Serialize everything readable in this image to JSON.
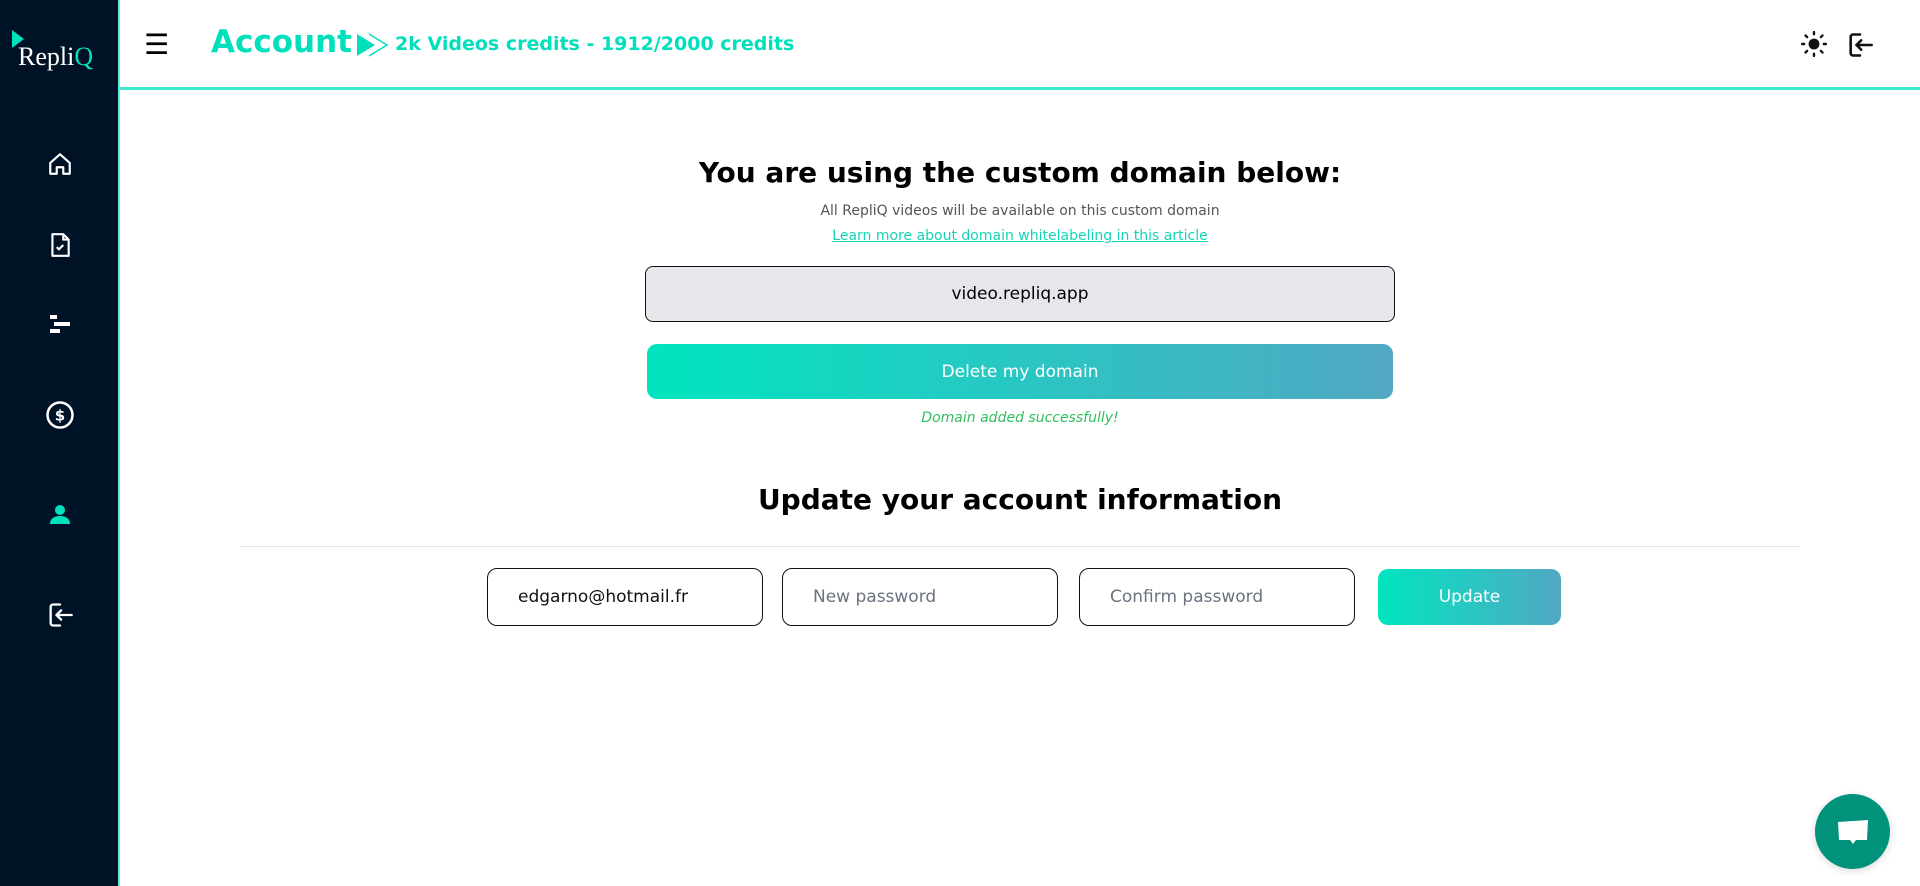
{
  "brand": {
    "name_prefix": "Repli",
    "name_suffix": "Q",
    "accent": "#00e0bd",
    "sidebar_bg": "#001226"
  },
  "sidebar": {
    "items": [
      {
        "icon": "home-icon",
        "active": false
      },
      {
        "icon": "document-check-icon",
        "active": false
      },
      {
        "icon": "bars-staggered-icon",
        "active": false
      },
      {
        "icon": "dollar-circle-icon",
        "active": false
      },
      {
        "icon": "user-icon",
        "active": true
      },
      {
        "icon": "logout-icon",
        "active": false
      }
    ]
  },
  "header": {
    "menu_glyph": "☰",
    "title": "Account",
    "credits": "2k Videos credits - 1912/2000 credits",
    "icons": [
      "sun-icon",
      "logout-icon"
    ]
  },
  "domain": {
    "heading": "You are using the custom domain below:",
    "subtitle": "All RepliQ videos will be available on this custom domain",
    "link": "Learn more about domain whitelabeling in this article",
    "value": "video.repliq.app",
    "delete_label": "Delete my domain",
    "success": "Domain added successfully!"
  },
  "account": {
    "heading": "Update your account information",
    "email": "edgarno@hotmail.fr",
    "new_password_placeholder": "New password",
    "confirm_password_placeholder": "Confirm password",
    "update_label": "Update"
  },
  "chat": {
    "icon": "chat-bubble-icon",
    "color": "#00927a"
  }
}
